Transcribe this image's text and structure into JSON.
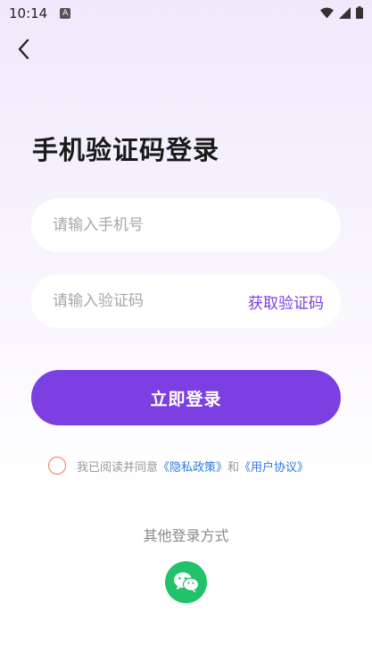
{
  "status_bar": {
    "time": "10:14",
    "notification_glyph": "A"
  },
  "header": {
    "back_icon": "chevron-left-icon"
  },
  "title": "手机验证码登录",
  "phone_input": {
    "placeholder": "请输入手机号",
    "value": ""
  },
  "code_input": {
    "placeholder": "请输入验证码",
    "value": "",
    "action_label": "获取验证码"
  },
  "login_button": {
    "label": "立即登录"
  },
  "agreement": {
    "prefix": "我已阅读并同意",
    "privacy_link": "《隐私政策》",
    "conjunction": "和",
    "user_link": "《用户协议》"
  },
  "other_login": {
    "label": "其他登录方式",
    "wechat_icon": "wechat-icon"
  },
  "colors": {
    "accent": "#7b3fe2",
    "get_code_text": "#7a3fe0",
    "link": "#2f7be0",
    "radio_border": "#ef7a4a",
    "wechat": "#21c26a"
  }
}
